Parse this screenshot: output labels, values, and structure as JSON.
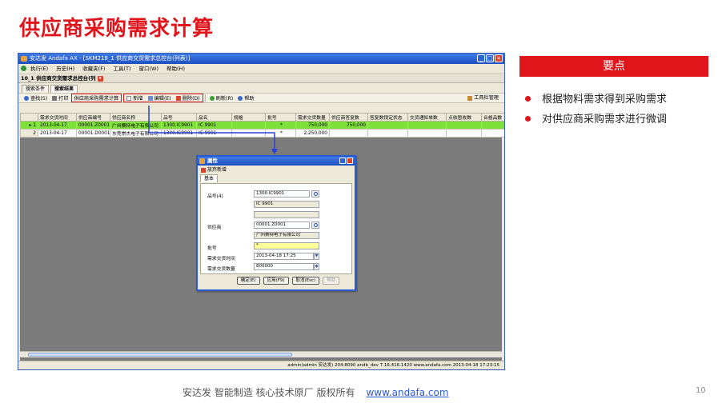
{
  "slide": {
    "title": "供应商采购需求计算",
    "key_points_header": "要点",
    "bullets": [
      "根据物料需求得到采购需求",
      "对供应商采购需求进行微调"
    ],
    "footer_text": "安达发   智能制造 核心技术原厂   版权所有",
    "footer_link": "www.andafa.com",
    "page_number": "10",
    "accent_color": "#e0141b"
  },
  "window": {
    "title": "安达发 Andafa AX - [SKM218_1 供应商交货需求总控台(列表)]",
    "menu": [
      "执行(E)",
      "历史(H)",
      "收藏夹(F)",
      "工具(T)",
      "窗口(W)",
      "帮助(H)"
    ],
    "doc_tab": "10_1 供应商交货需求总控台(列",
    "sub_tabs": [
      "搜索条件",
      "搜索结果"
    ],
    "toolbar": {
      "search": "查找(S)",
      "print": "打印",
      "calc": "供应商采购需求计算",
      "add": "新增",
      "edit": "编辑(E)",
      "delete": "删除(D)",
      "refresh": "刷新(R)",
      "help": "帮助",
      "toolbar_manage": "工具栏管理"
    },
    "grid": {
      "columns": [
        "需求交货时间",
        "供应商编号",
        "供应商名称",
        "品号",
        "品名",
        "规格",
        "批号",
        "需求交货数量",
        "供应商答复数",
        "答复数锁定状态",
        "交货通知单数",
        "点收暂收数",
        "合格品数"
      ],
      "rows": [
        {
          "n": "1",
          "cells": [
            "2013-04-17",
            "00001.Z0001",
            "广州赛特电子有限公司",
            "1300.IC9901",
            "IC 9901",
            "",
            "*",
            "750,000",
            "750,000",
            "",
            "",
            "",
            ""
          ]
        },
        {
          "n": "2",
          "cells": [
            "2013-04-17",
            "00001.D0001",
            "东莞崇杰电子有限公司",
            "1300.IC9901",
            "IC 9901",
            "",
            "*",
            "2,250,000",
            "",
            "",
            "",
            "",
            ""
          ]
        }
      ]
    },
    "status": "admin(admin 安达发)   204:8090   andb_dev   7.16.416.1420   www.andafa.com   2013-04-18 17:23:15"
  },
  "dialog": {
    "title": "属性",
    "toolbar_btn": "放弃新增",
    "tab": "基本",
    "fields": {
      "item_label": "品号(4)",
      "item_value": "1300.IC9901",
      "item_name": "IC 9901",
      "item_spec": "",
      "supplier_label": "供应商",
      "supplier_value": "00001.Z0001",
      "supplier_name": "广州赛特电子有限公司",
      "batch_label": "批号",
      "batch_value": "*",
      "time_label": "需求交货时间",
      "time_value": "2013-04-18 17:25",
      "qty_label": "需求交货数量",
      "qty_value": "800000"
    },
    "buttons": [
      "确定(E)",
      "应用(F9)",
      "取消(Esc)",
      "帮助"
    ]
  }
}
